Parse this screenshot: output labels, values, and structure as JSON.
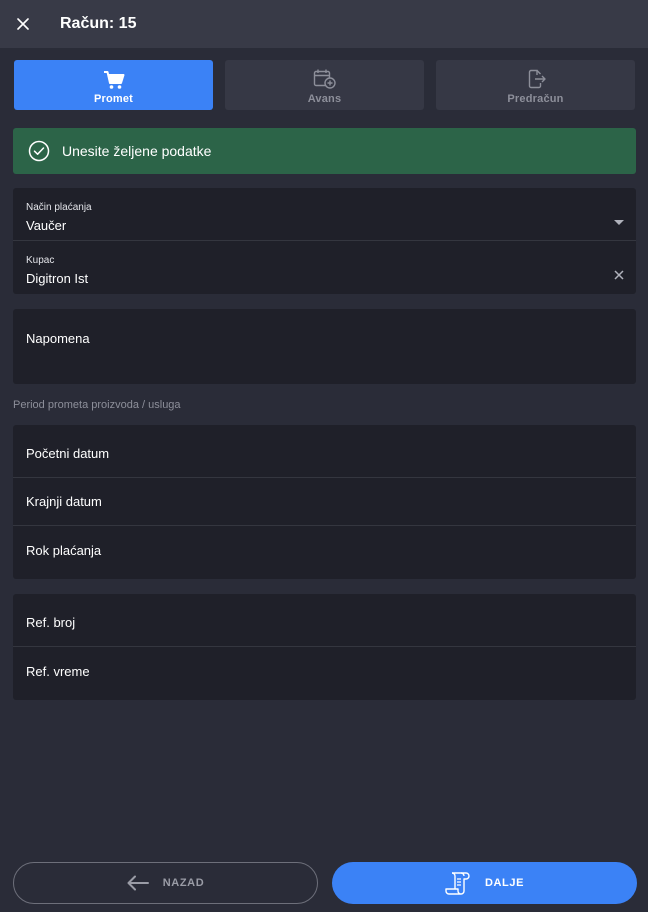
{
  "header": {
    "title": "Račun: 15",
    "close_icon": "close-icon"
  },
  "tabs": [
    {
      "label": "Promet",
      "icon": "cart-icon",
      "active": true
    },
    {
      "label": "Avans",
      "icon": "calendar-plus-icon",
      "active": false
    },
    {
      "label": "Predračun",
      "icon": "document-export-icon",
      "active": false
    }
  ],
  "alert": {
    "text": "Unesite željene podatke",
    "icon": "check-circle-icon",
    "color": "#2c6448"
  },
  "payment": {
    "method_label": "Način plaćanja",
    "method_value": "Vaučer",
    "customer_label": "Kupac",
    "customer_value": "Digitron Ist"
  },
  "note": {
    "label": "Napomena"
  },
  "period": {
    "section_label": "Period prometa proizvoda / usluga",
    "start_label": "Početni datum",
    "end_label": "Krajnji datum",
    "due_label": "Rok plaćanja"
  },
  "reference": {
    "number_label": "Ref. broj",
    "time_label": "Ref. vreme"
  },
  "footer": {
    "back_label": "NAZAD",
    "next_label": "DALJE"
  },
  "colors": {
    "accent": "#3b82f6",
    "background": "#2a2c38",
    "card": "#1f2029",
    "header": "#383a47"
  }
}
